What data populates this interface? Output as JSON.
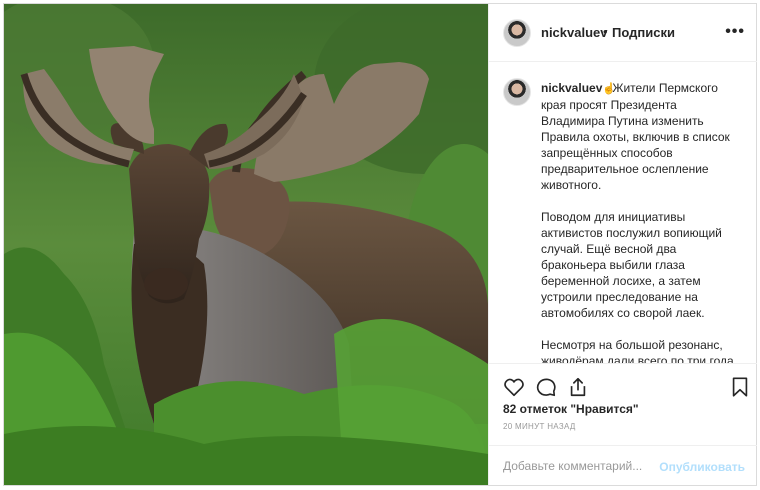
{
  "post": {
    "author": "nickvaluev",
    "separator": "•",
    "follow_status": "Подписки",
    "more_icon": "more-horizontal-icon",
    "photo_subject": "moose-photo"
  },
  "caption": {
    "username": "nickvaluev",
    "emoji": "pointing-hand-emoji",
    "paragraph_1": "Жители Пермского края просят Президента Владимира Путина изменить Правила охоты, включив в список запрещённых способов предварительное ослепление животного.",
    "paragraph_2": "Поводом для инициативы активистов послужил вопиющий случай. Ещё весной два браконьера выбили глаза беременной лосихе, а затем устроили преследование на автомобилях со сворой лаек.",
    "paragraph_3": "Несмотря на большой резонанс, живодёрам дали всего по три года условно. Прокуратура Пермского края не усмотрела отягчающих обстоятельств, поскольку добыча"
  },
  "actions": {
    "like_icon": "heart-icon",
    "comment_icon": "comment-icon",
    "share_icon": "share-icon",
    "save_icon": "bookmark-icon"
  },
  "likes": "82 отметок \"Нравится\"",
  "timestamp": "20 МИНУТ НАЗАД",
  "comment": {
    "placeholder": "Добавьте комментарий...",
    "value": "",
    "publish_label": "Опубликовать"
  },
  "colors": {
    "text": "#262626",
    "muted": "#999999",
    "border": "#dbdbdb",
    "publish_disabled": "#b2dffc"
  }
}
